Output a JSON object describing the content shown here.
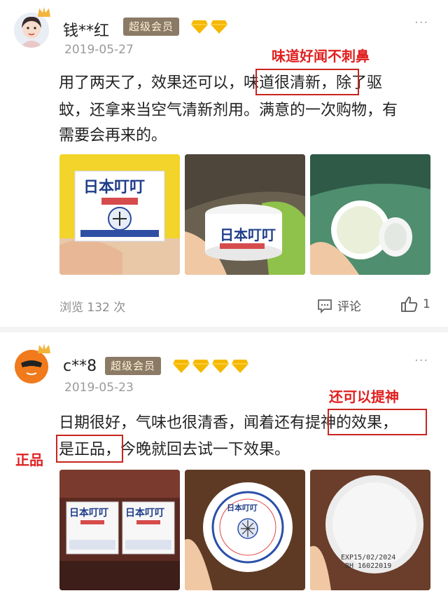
{
  "reviews": [
    {
      "username": "钱**红",
      "badge": "超级会员",
      "diamond_count": 2,
      "date": "2019-05-27",
      "more": "···",
      "text_lines": [
        "用了两天了，效果还可以，味道很清新，除了驱",
        "蚊，还拿来当空气清新剂用。满意的一次购物，有",
        "需要会再来的。"
      ],
      "text_line1_parts": [
        "用了两天了，效果还可以，",
        "味道很清新，",
        "除了驱"
      ],
      "annotation": "味道好闻不刺鼻",
      "views": "浏览 132 次",
      "comment_label": "评论",
      "like_count": "1",
      "photo_labels": [
        "日本叮叮",
        "日本叮叮"
      ]
    },
    {
      "username": "c**8",
      "badge": "超级会员",
      "diamond_count": 4,
      "date": "2019-05-23",
      "more": "···",
      "text_line1_parts": [
        "日期很好，气味也很清香，闻着还有",
        "提神的效果，"
      ],
      "text_line2_parts": [
        "是正品，",
        "今晚就回去试一下效果。"
      ],
      "annotation_right": "还可以提神",
      "annotation_left": "正品",
      "photo_labels": [
        "日本叮叮",
        "日本叮叮",
        "日本叮叮"
      ],
      "date_print": [
        "EXP15/02/2024",
        "BH 16022019"
      ]
    }
  ],
  "colors": {
    "badge_bg": "#8a7a66",
    "annotation_red": "#e0201f",
    "diamond": "#f5b800"
  }
}
